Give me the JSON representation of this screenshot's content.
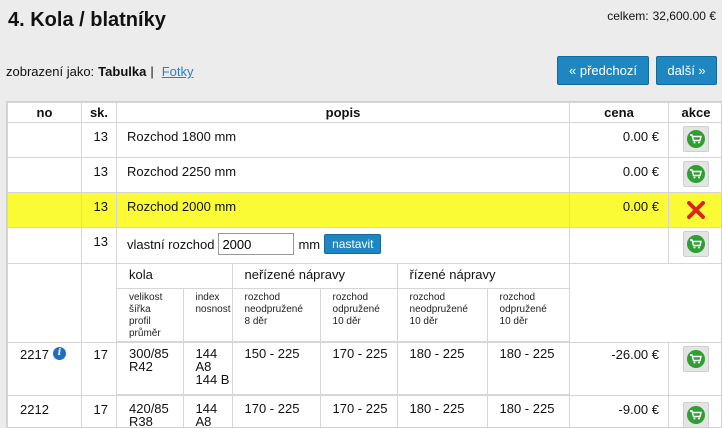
{
  "header": {
    "title": "4. Kola / blatníky",
    "total_label": "celkem:",
    "total_value": "32,600.00 €"
  },
  "view": {
    "label": "zobrazení jako:",
    "current": "Tabulka",
    "separator": "|",
    "alt": "Fotky"
  },
  "nav": {
    "prev": "« předchozí",
    "next": "další »"
  },
  "table": {
    "headers": {
      "no": "no",
      "sk": "sk.",
      "popis": "popis",
      "cena": "cena",
      "akce": "akce"
    },
    "rows": [
      {
        "sk": "13",
        "popis": "Rozchod 1800 mm",
        "cena": "0.00 €"
      },
      {
        "sk": "13",
        "popis": "Rozchod 2250 mm",
        "cena": "0.00 €"
      },
      {
        "sk": "13",
        "popis": "Rozchod 2000 mm",
        "cena": "0.00 €"
      }
    ],
    "custom": {
      "sk": "13",
      "label": "vlastní rozchod",
      "value": "2000",
      "unit": "mm",
      "button": "nastavit"
    },
    "sub_groups": {
      "kola": "kola",
      "unsprung": "neřízené nápravy",
      "steered": "řízené nápravy"
    },
    "sub_headers": {
      "kola1": [
        "velikost",
        "šířka",
        "profil",
        "průměr"
      ],
      "kola2": [
        "index",
        "nosnost"
      ],
      "u1": [
        "rozchod",
        "neodpružené",
        "8 děr"
      ],
      "u2": [
        "rozchod",
        "odpružené",
        "10 děr"
      ],
      "s1": [
        "rozchod",
        "neodpružené",
        "10 děr"
      ],
      "s2": [
        "rozchod",
        "odpružené",
        "10 děr"
      ]
    },
    "products": [
      {
        "no": "2217",
        "sk": "17",
        "size": [
          "300/85",
          "R42"
        ],
        "index": [
          "144",
          "A8",
          "144 B"
        ],
        "u1": "150 - 225",
        "u2": "170 - 225",
        "s1": "180 - 225",
        "s2": "180 - 225",
        "cena": "-26.00 €"
      },
      {
        "no": "2212",
        "sk": "17",
        "size": [
          "420/85",
          "R38"
        ],
        "index": [
          "144",
          "A8"
        ],
        "u1": "170 - 225",
        "u2": "170 - 225",
        "s1": "180 - 225",
        "s2": "180 - 225",
        "cena": "-9.00 €"
      }
    ]
  },
  "icons": {
    "cart": "shopping-cart-icon",
    "remove": "remove-x-icon",
    "info": "info-icon"
  },
  "colors": {
    "accent": "#1e87c2",
    "highlight": "#fbfb35",
    "cart_green": "#2f9e33",
    "remove_red": "#d9261c"
  }
}
